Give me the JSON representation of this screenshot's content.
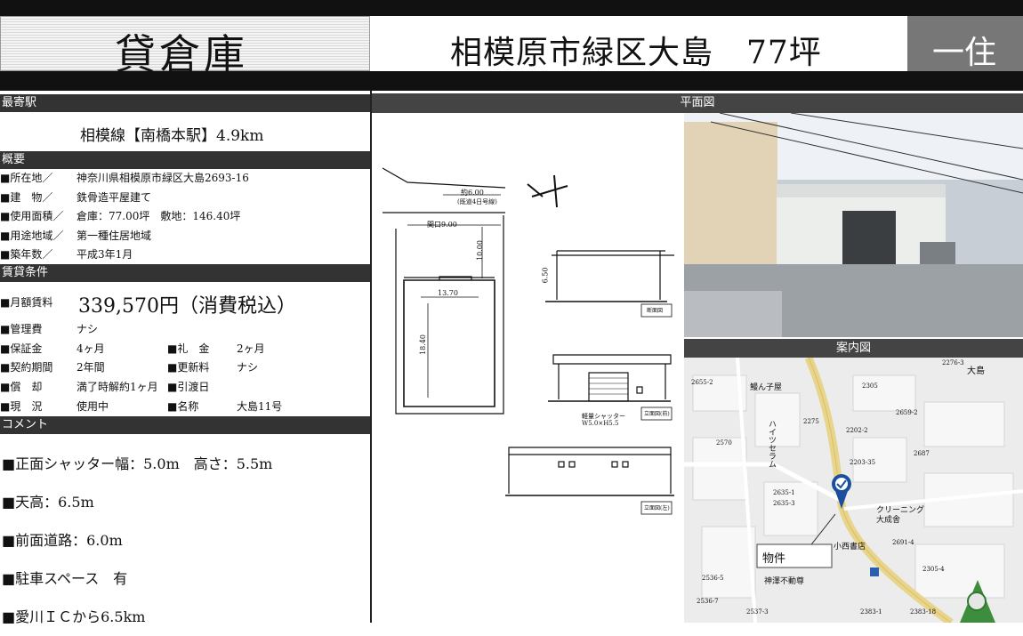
{
  "header": {
    "type": "貸倉庫",
    "location_size": "相模原市緑区大島　77坪",
    "zoning_short": "一住"
  },
  "station": {
    "heading": "最寄駅",
    "text": "相模線【南橋本駅】4.9km"
  },
  "overview": {
    "heading": "概要",
    "rows": [
      {
        "label": "■所在地／",
        "value": "神奈川県相模原市緑区大島2693-16"
      },
      {
        "label": "■建　物／",
        "value": "鉄骨造平屋建て"
      },
      {
        "label": "■使用面積／",
        "value": "倉庫：77.00坪　敷地：146.40坪"
      },
      {
        "label": "■用途地域／",
        "value": "第一種住居地域"
      },
      {
        "label": "■築年数／",
        "value": "平成3年1月"
      }
    ]
  },
  "lease": {
    "heading": "賃貸条件",
    "rent_label": "■月額賃料",
    "rent_value": "339,570円（消費税込）",
    "mgmt_label": "■管理費",
    "mgmt_value": "ナシ",
    "pairs": [
      {
        "l1": "■保証金",
        "v1": "4ヶ月",
        "l2": "■礼　金",
        "v2": "2ヶ月"
      },
      {
        "l1": "■契約期間",
        "v1": "2年間",
        "l2": "■更新料",
        "v2": "ナシ"
      },
      {
        "l1": "■償　却",
        "v1": "満了時解約1ヶ月",
        "l2": "■引渡日",
        "v2": ""
      },
      {
        "l1": "■現　況",
        "v1": "使用中",
        "l2": "■名称",
        "v2": "大島11号"
      }
    ]
  },
  "comment": {
    "heading": "コメント",
    "lines": [
      "■正面シャッター幅：5.0m　高さ：5.5m",
      "■天高：6.5m",
      "■前面道路：6.0m",
      "■駐車スペース　有",
      "■愛川ＩＣから6.5km"
    ]
  },
  "plan": {
    "heading": "平面図",
    "dim_road": "約6.00",
    "dim_road_sub": "(既道4日号線)",
    "dim_frontage": "間口9.00",
    "dim_depth": "10.00",
    "dim_width": "13.70",
    "dim_length": "18.40",
    "dim_height": "6.50",
    "label_section": "断面図",
    "label_front": "立面図(前)",
    "label_side": "立面図(左)",
    "shutter_label": "軽量シャッター",
    "shutter_size": "W5.0×H5.5"
  },
  "map": {
    "heading": "案内図",
    "property_label": "物件",
    "places": [
      "大島",
      "鰻ん子屋",
      "ハイツセラム",
      "クリーニング",
      "大成舎",
      "小西書店",
      "神澤不動尊"
    ],
    "block_numbers": [
      "2276-3",
      "2655-2",
      "2305",
      "2659-2",
      "2275",
      "2202-2",
      "2570",
      "2203-35",
      "2687",
      "2635-1",
      "2635-3",
      "2691-4",
      "2305-4",
      "2536-5",
      "2383-1",
      "2383-18",
      "2537-3",
      "2536-7"
    ]
  },
  "colors": {
    "section_bg": "#333333",
    "header_right_bg": "#777777",
    "pin": "#1a4fa0"
  }
}
